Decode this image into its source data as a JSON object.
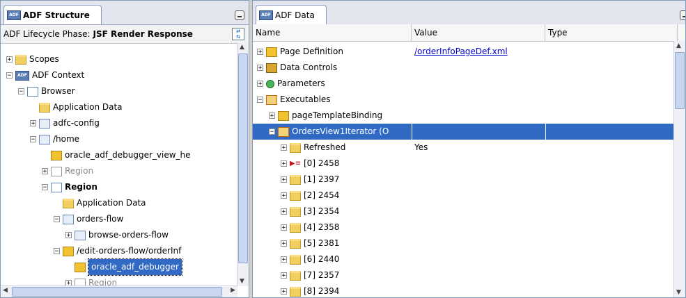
{
  "left_panel": {
    "tab_title": "ADF Structure",
    "tab_icon": "ADF",
    "phase_label": "ADF Lifecycle Phase:",
    "phase_value": "JSF Render Response",
    "tree": [
      {
        "label": "Scopes",
        "icon": "folder",
        "expander": "+"
      },
      {
        "label": "ADF Context",
        "icon": "adf-icon",
        "expander": "-"
      },
      {
        "label": "Browser",
        "icon": "box",
        "expander": "-"
      },
      {
        "label": "Application Data",
        "icon": "folder",
        "expander": ""
      },
      {
        "label": "adfc-config",
        "icon": "flow",
        "expander": "+"
      },
      {
        "label": "/home",
        "icon": "page-def",
        "expander": "-"
      },
      {
        "label": "oracle_adf_debugger_view_he",
        "icon": "page",
        "expander": ""
      },
      {
        "label": "Region",
        "icon": "region-grey",
        "expander": "+"
      },
      {
        "label": "Region",
        "icon": "box",
        "expander": "-"
      },
      {
        "label": "Application Data",
        "icon": "folder",
        "expander": ""
      },
      {
        "label": "orders-flow",
        "icon": "flow",
        "expander": "-"
      },
      {
        "label": "browse-orders-flow",
        "icon": "flow",
        "expander": "+"
      },
      {
        "label": "/edit-orders-flow/orderInf",
        "icon": "green-page",
        "expander": "-"
      },
      {
        "label": "oracle_adf_debugger",
        "icon": "page",
        "expander": ""
      },
      {
        "label": "Region",
        "icon": "region-grey",
        "expander": "+"
      }
    ]
  },
  "right_panel": {
    "tab_title": "ADF Data",
    "tab_icon": "ADF",
    "columns": [
      "Name",
      "Value",
      "Type"
    ],
    "rows": [
      {
        "name": "Page Definition",
        "value": "/orderInfoPageDef.xml",
        "type": "",
        "icon": "page",
        "expander": "+"
      },
      {
        "name": "Data Controls",
        "value": "",
        "type": "",
        "icon": "data-controls",
        "expander": "+"
      },
      {
        "name": "Parameters",
        "value": "",
        "type": "",
        "icon": "parameters",
        "expander": "+"
      },
      {
        "name": "Executables",
        "value": "",
        "type": "",
        "icon": "executables",
        "expander": "-"
      },
      {
        "name": "pageTemplateBinding",
        "value": "",
        "type": "",
        "icon": "page",
        "expander": "+"
      },
      {
        "name": "OrdersView1Iterator (O",
        "value": "",
        "type": "",
        "icon": "executables",
        "expander": "-"
      },
      {
        "name": "Refreshed",
        "value": "Yes",
        "type": "",
        "icon": "folder",
        "expander": "+"
      },
      {
        "name": "[0] 2458",
        "value": "",
        "type": "",
        "icon": "current-row",
        "expander": "+"
      },
      {
        "name": "[1] 2397",
        "value": "",
        "type": "",
        "icon": "folder",
        "expander": "+"
      },
      {
        "name": "[2] 2454",
        "value": "",
        "type": "",
        "icon": "folder",
        "expander": "+"
      },
      {
        "name": "[3] 2354",
        "value": "",
        "type": "",
        "icon": "folder",
        "expander": "+"
      },
      {
        "name": "[4] 2358",
        "value": "",
        "type": "",
        "icon": "folder",
        "expander": "+"
      },
      {
        "name": "[5] 2381",
        "value": "",
        "type": "",
        "icon": "folder",
        "expander": "+"
      },
      {
        "name": "[6] 2440",
        "value": "",
        "type": "",
        "icon": "folder",
        "expander": "+"
      },
      {
        "name": "[7] 2357",
        "value": "",
        "type": "",
        "icon": "folder",
        "expander": "+"
      },
      {
        "name": "[8] 2394",
        "value": "",
        "type": "",
        "icon": "folder",
        "expander": "+"
      }
    ]
  },
  "colors": {
    "selection": "#316ac5",
    "link": "#0000cc"
  }
}
